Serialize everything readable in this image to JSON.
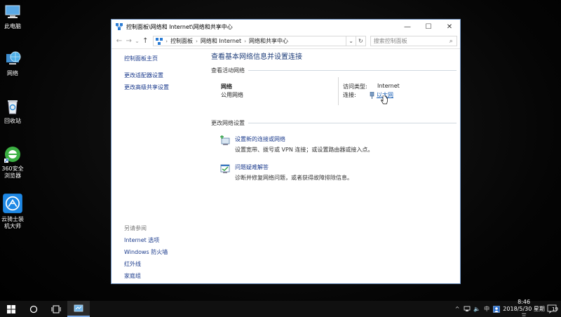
{
  "desktop": {
    "icons": [
      {
        "label": "此电脑",
        "icon": "computer-icon"
      },
      {
        "label": "网络",
        "icon": "network-globe-icon"
      },
      {
        "label": "回收站",
        "icon": "recycle-bin-icon"
      },
      {
        "label": "360安全浏览器",
        "icon": "browser-icon"
      },
      {
        "label": "云骑士装机大师",
        "icon": "app-icon"
      }
    ]
  },
  "window": {
    "title": "控制面板\\网络和 Internet\\网络和共享中心",
    "controls": {
      "minimize": "—",
      "maximize": "☐",
      "close": "✕"
    },
    "nav": {
      "back": "←",
      "forward": "→",
      "recent": "⌄",
      "up": "↑",
      "breadcrumbs": [
        "控制面板",
        "网络和 Internet",
        "网络和共享中心"
      ],
      "separator": "›",
      "dropdown": "⌄",
      "refresh": "↻",
      "search_placeholder": "搜索控制面板",
      "search_icon": "⌕"
    },
    "sidebar": {
      "links": [
        "控制面板主页",
        "更改适配器设置",
        "更改高级共享设置"
      ],
      "see_also_header": "另请参阅",
      "see_also": [
        "Internet 选项",
        "Windows 防火墙",
        "红外线",
        "家庭组"
      ]
    },
    "main": {
      "title": "查看基本网络信息并设置连接",
      "active_header": "查看活动网络",
      "network_name": "网络",
      "network_type": "公用网络",
      "access_type_label": "访问类型:",
      "access_type_value": "Internet",
      "connection_label": "连接:",
      "connection_value": "以太网",
      "change_header": "更改网络设置",
      "tasks": [
        {
          "title": "设置新的连接或网络",
          "desc": "设置宽带、拨号或 VPN 连接；或设置路由器或接入点。"
        },
        {
          "title": "问题疑难解答",
          "desc": "诊断并修复网络问题，或者获得故障排除信息。"
        }
      ]
    }
  },
  "taskbar": {
    "start_icon": "windows-start-icon",
    "tray": {
      "chevron": "^",
      "volume": "🔈",
      "ime": "中",
      "time": "8:46",
      "date": "2018/5/30 星期三",
      "notifications": "19"
    }
  },
  "colors": {
    "link": "#1a3a8c",
    "title": "#1e3d7a",
    "taskbar": "#101010"
  }
}
